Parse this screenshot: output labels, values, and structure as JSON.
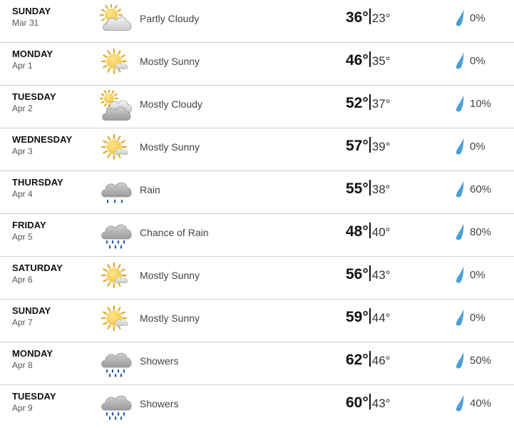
{
  "colors": {
    "row_divider": "#cfcfcf",
    "drop_blue": "#4a9fd8",
    "sun_yellow": "#f5c84b",
    "cloud_gray": "#9a9a9a"
  },
  "forecast": [
    {
      "day": "SUNDAY",
      "date": "Mar 31",
      "condition": "Partly Cloudy",
      "icon": "partly-cloudy-icon",
      "high": "36°",
      "low": "23°",
      "precip": "0%"
    },
    {
      "day": "MONDAY",
      "date": "Apr 1",
      "condition": "Mostly Sunny",
      "icon": "mostly-sunny-icon",
      "high": "46°",
      "low": "35°",
      "precip": "0%"
    },
    {
      "day": "TUESDAY",
      "date": "Apr 2",
      "condition": "Mostly Cloudy",
      "icon": "mostly-cloudy-icon",
      "high": "52°",
      "low": "37°",
      "precip": "10%"
    },
    {
      "day": "WEDNESDAY",
      "date": "Apr 3",
      "condition": "Mostly Sunny",
      "icon": "mostly-sunny-icon",
      "high": "57°",
      "low": "39°",
      "precip": "0%"
    },
    {
      "day": "THURSDAY",
      "date": "Apr 4",
      "condition": "Rain",
      "icon": "rain-icon",
      "high": "55°",
      "low": "38°",
      "precip": "60%"
    },
    {
      "day": "FRIDAY",
      "date": "Apr 5",
      "condition": "Chance of Rain",
      "icon": "heavy-rain-icon",
      "high": "48°",
      "low": "40°",
      "precip": "80%"
    },
    {
      "day": "SATURDAY",
      "date": "Apr 6",
      "condition": "Mostly Sunny",
      "icon": "mostly-sunny-icon",
      "high": "56°",
      "low": "43°",
      "precip": "0%"
    },
    {
      "day": "SUNDAY",
      "date": "Apr 7",
      "condition": "Mostly Sunny",
      "icon": "mostly-sunny-icon",
      "high": "59°",
      "low": "44°",
      "precip": "0%"
    },
    {
      "day": "MONDAY",
      "date": "Apr 8",
      "condition": "Showers",
      "icon": "showers-icon",
      "high": "62°",
      "low": "46°",
      "precip": "50%"
    },
    {
      "day": "TUESDAY",
      "date": "Apr 9",
      "condition": "Showers",
      "icon": "showers-icon",
      "high": "60°",
      "low": "43°",
      "precip": "40%"
    }
  ]
}
